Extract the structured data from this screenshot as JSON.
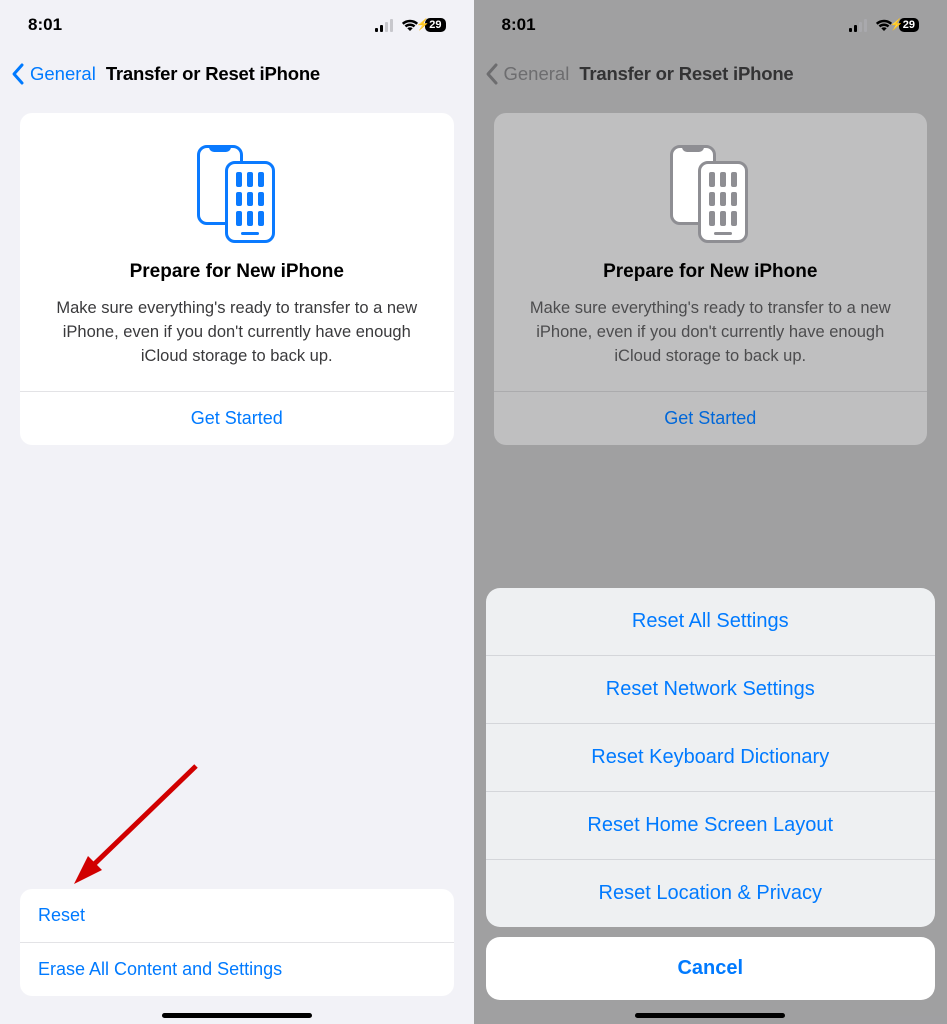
{
  "status": {
    "time": "8:01",
    "battery": "29"
  },
  "nav": {
    "back_label": "General",
    "title": "Transfer or Reset iPhone"
  },
  "card": {
    "title": "Prepare for New iPhone",
    "body": "Make sure everything's ready to transfer to a new iPhone, even if you don't currently have enough iCloud storage to back up.",
    "action": "Get Started"
  },
  "left_rows": {
    "reset": "Reset",
    "erase": "Erase All Content and Settings"
  },
  "sheet": {
    "options": [
      "Reset All Settings",
      "Reset Network Settings",
      "Reset Keyboard Dictionary",
      "Reset Home Screen Layout",
      "Reset Location & Privacy"
    ],
    "cancel": "Cancel"
  }
}
